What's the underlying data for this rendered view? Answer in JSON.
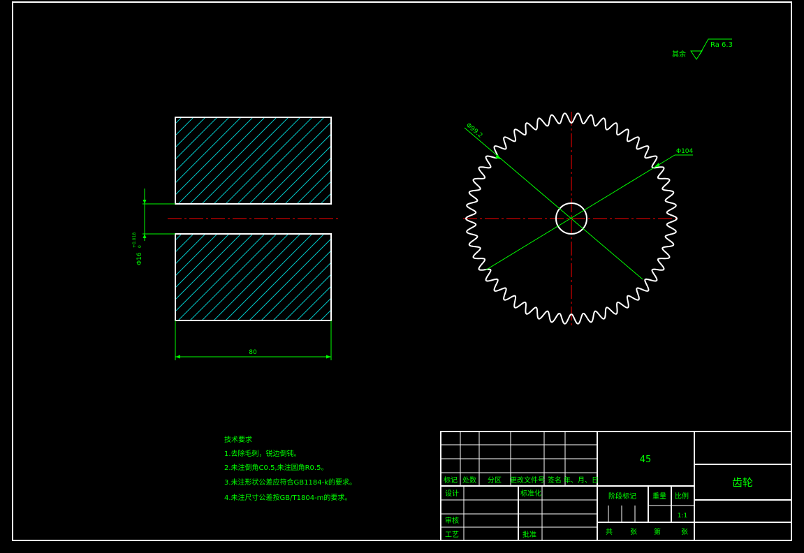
{
  "colors": {
    "background": "#000000",
    "outline": "#ffffff",
    "dimension": "#00ff00",
    "centerline": "#ff0000",
    "hatch": "#00c8c8"
  },
  "surface_finish": {
    "prefix": "其余",
    "value": "Ra 6.3"
  },
  "section_view": {
    "bore_dimension": "Φ16",
    "bore_tolerance_upper": "+0.018",
    "bore_tolerance_lower": "0",
    "width_dimension": "80"
  },
  "gear_view": {
    "root_diameter": "Φ99.2",
    "tip_diameter": "Φ104"
  },
  "technical_requirements": {
    "title": "技术要求",
    "items": [
      "1.去除毛刺，锐边倒钝。",
      "2.未注倒角C0.5,未注圆角R0.5。",
      "3.未注形状公差应符合GB1184-k的要求。",
      "4.未注尺寸公差按GB/T1804-m的要求。"
    ]
  },
  "title_block": {
    "material": "45",
    "part_name": "齿轮",
    "revision_headers": [
      "标记",
      "处数",
      "分区",
      "更改文件号",
      "签名",
      "年、月、日"
    ],
    "designer_label": "设计",
    "standardization_label": "标准化",
    "checker_label": "审核",
    "process_label": "工艺",
    "approval_label": "批准",
    "stage_label": "阶段标记",
    "weight_label": "重量",
    "scale_label": "比例",
    "scale_value": "1:1",
    "sheet_total_label": "共",
    "sheet_unit_label": "张",
    "sheet_number_label": "第",
    "sheet_unit2_label": "张"
  }
}
